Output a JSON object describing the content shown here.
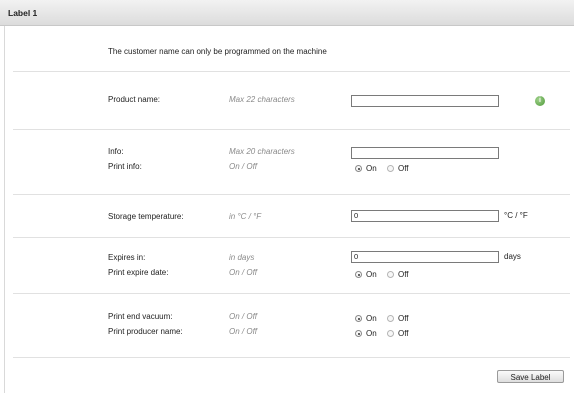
{
  "window": {
    "title": "Label 1"
  },
  "notice": "The customer name can only be programmed on the machine",
  "product": {
    "label": "Product name:",
    "hint": "Max 22 characters",
    "value": ""
  },
  "info": {
    "label": "Info:",
    "hint": "Max 20 characters",
    "value": "",
    "print_label": "Print info:",
    "print_hint": "On / Off",
    "on": "On",
    "off": "Off"
  },
  "storage": {
    "label": "Storage temperature:",
    "hint": "in °C / °F",
    "value": "0",
    "unit": "°C / °F"
  },
  "expires": {
    "label": "Expires in:",
    "hint": "in days",
    "value": "0",
    "unit": "days",
    "print_label": "Print expire date:",
    "print_hint": "On / Off",
    "on": "On",
    "off": "Off"
  },
  "vacuum": {
    "label": "Print end vacuum:",
    "hint": "On / Off",
    "on": "On",
    "off": "Off"
  },
  "producer": {
    "label": "Print producer name:",
    "hint": "On / Off",
    "on": "On",
    "off": "Off"
  },
  "save_button": "Save Label",
  "icons": {
    "info": "info-icon"
  },
  "colors": {
    "info_icon": "#5fa84a",
    "separator": "#e1e1e1"
  }
}
